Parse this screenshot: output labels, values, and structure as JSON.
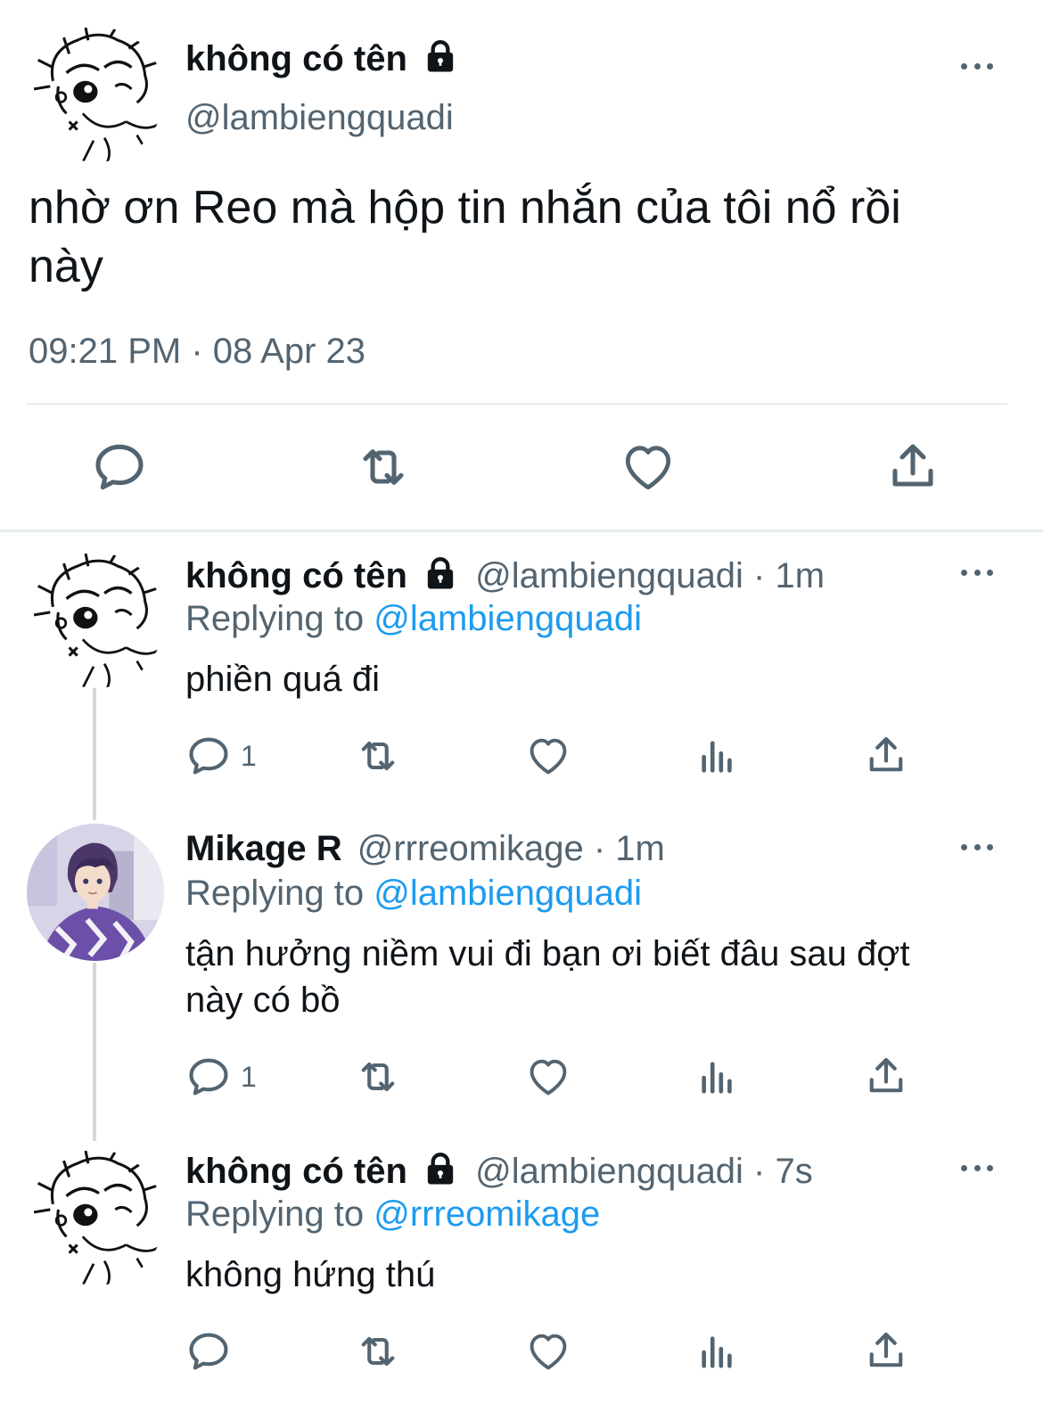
{
  "main_tweet": {
    "display_name": "không có tên",
    "handle": "@lambiengquadi",
    "text_line1": "nhờ ơn Reo mà hộp tin nhắn của tôi nổ rồi",
    "text_line2": "này",
    "timestamp": "09:21 PM · 08 Apr 23"
  },
  "replies": [
    {
      "display_name": "không có tên",
      "handle_time": "@lambiengquadi · 1m",
      "replying_prefix": "Replying to",
      "replying_to": "@lambiengquadi",
      "text_line1": "phiền quá đi",
      "text_line2": "",
      "reply_count": "1"
    },
    {
      "display_name": "Mikage R",
      "handle_time": "@rrreomikage · 1m",
      "replying_prefix": "Replying to",
      "replying_to": "@lambiengquadi",
      "text_line1": "tận hưởng niềm vui đi bạn ơi biết đâu sau đợt",
      "text_line2": "này có bồ",
      "reply_count": "1"
    },
    {
      "display_name": "không có tên",
      "handle_time": "@lambiengquadi · 7s",
      "replying_prefix": "Replying to",
      "replying_to": "@rrreomikage",
      "text_line1": "không hứng thú",
      "text_line2": "",
      "reply_count": ""
    }
  ],
  "icons": {
    "reply": "reply-icon",
    "retweet": "retweet-icon",
    "like": "heart-icon",
    "views": "views-icon",
    "share": "share-icon",
    "more": "more-icon",
    "lock": "lock-icon"
  },
  "colors": {
    "text": "#0f1419",
    "muted": "#536471",
    "link": "#1d9bf0",
    "divider": "#e6ecf0"
  }
}
